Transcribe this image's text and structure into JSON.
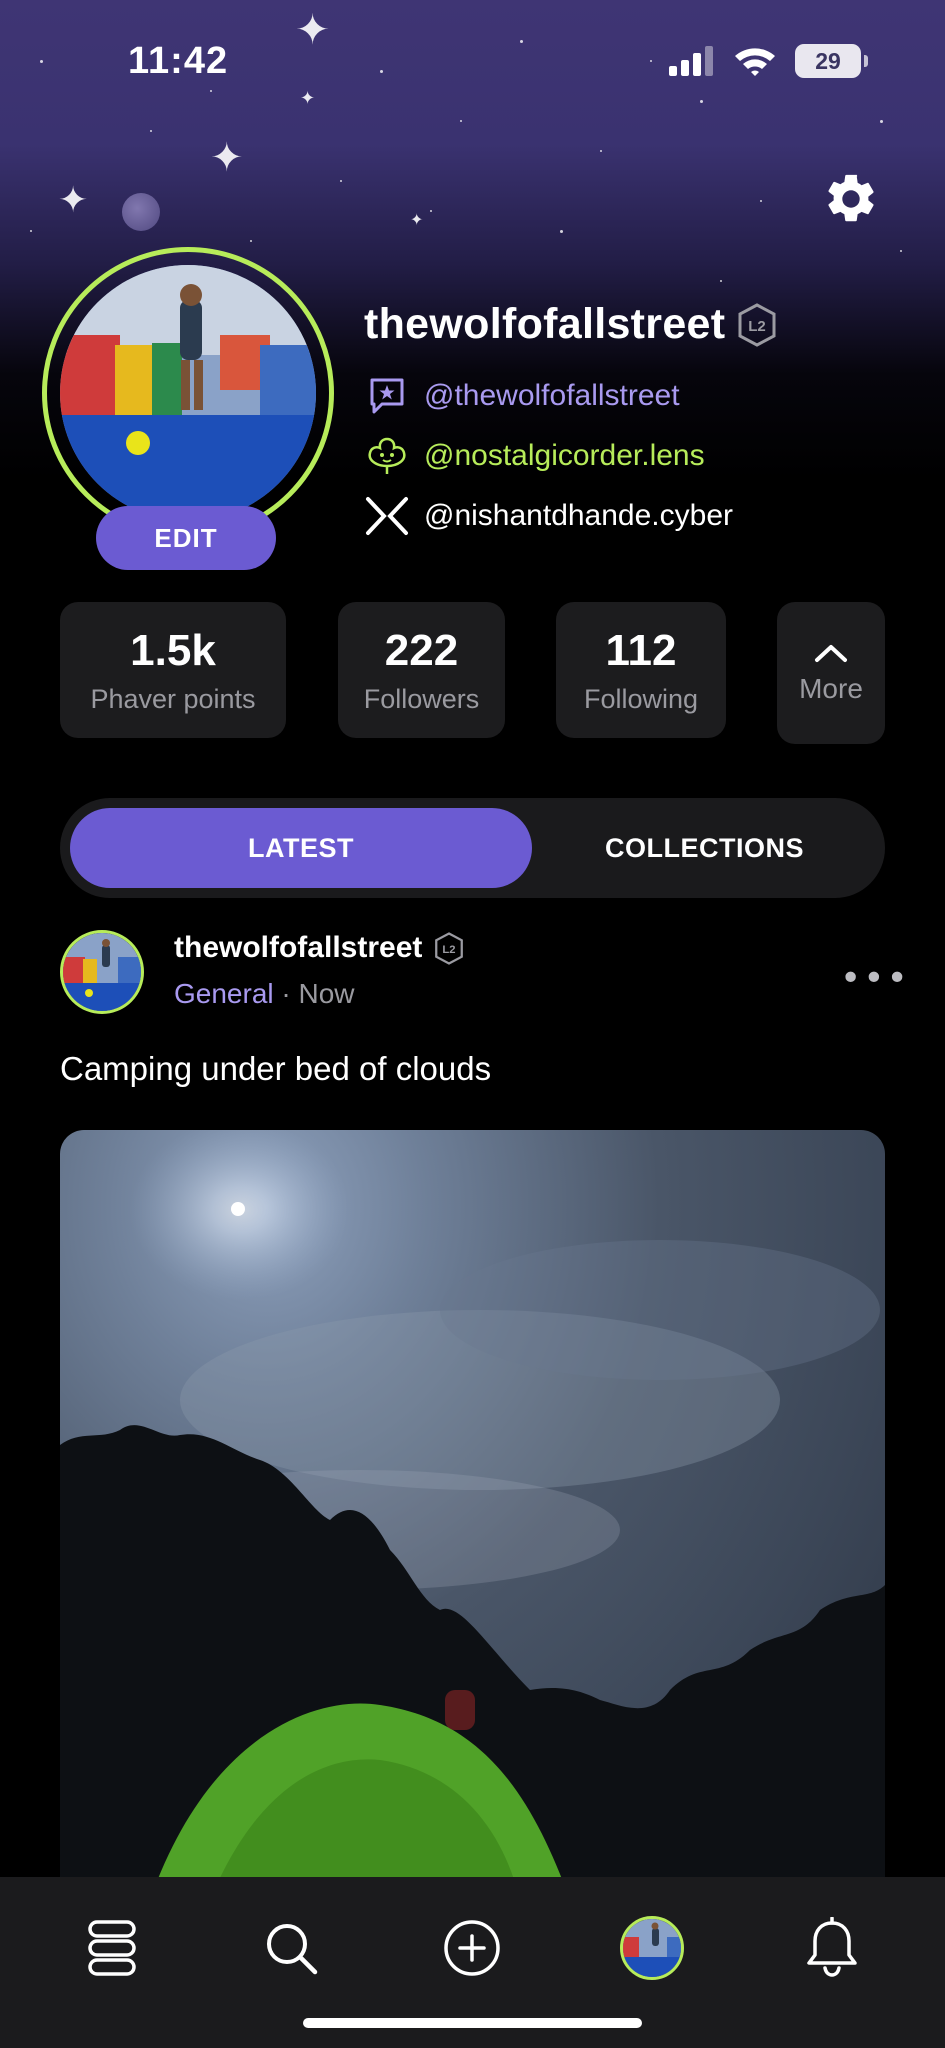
{
  "status_bar": {
    "time": "11:42",
    "battery": "29",
    "icons": [
      "cellular-signal-icon",
      "wifi-icon",
      "battery-icon"
    ]
  },
  "header": {
    "settings_icon": "gear-icon"
  },
  "profile": {
    "username": "thewolfofallstreet",
    "level_badge": "L2",
    "edit_label": "EDIT",
    "handles": [
      {
        "icon": "phaver-chat-icon",
        "text": "@thewolfofallstreet",
        "color": "#a99af0"
      },
      {
        "icon": "lens-icon",
        "text": "@nostalgicorder.lens",
        "color": "#b7ec5a"
      },
      {
        "icon": "x-icon",
        "text": "@nishantdhande.cyber",
        "color": "#ffffff"
      }
    ],
    "ring_color": "#b7ec5a"
  },
  "stats": [
    {
      "value": "1.5k",
      "label": "Phaver points"
    },
    {
      "value": "222",
      "label": "Followers"
    },
    {
      "value": "112",
      "label": "Following"
    }
  ],
  "more": {
    "label": "More",
    "icon": "chevron-up-icon"
  },
  "tabs": {
    "active": "LATEST",
    "inactive": "COLLECTIONS",
    "accent": "#6b5bd2"
  },
  "post": {
    "author": "thewolfofallstreet",
    "level_badge": "L2",
    "category": "General",
    "separator": " · ",
    "time": "Now",
    "caption": "Camping under bed of clouds",
    "more_icon": "more-horizontal-icon"
  },
  "bottom_nav": {
    "items": [
      "feed-icon",
      "search-icon",
      "create-post-icon",
      "profile-avatar",
      "notifications-bell-icon"
    ]
  }
}
